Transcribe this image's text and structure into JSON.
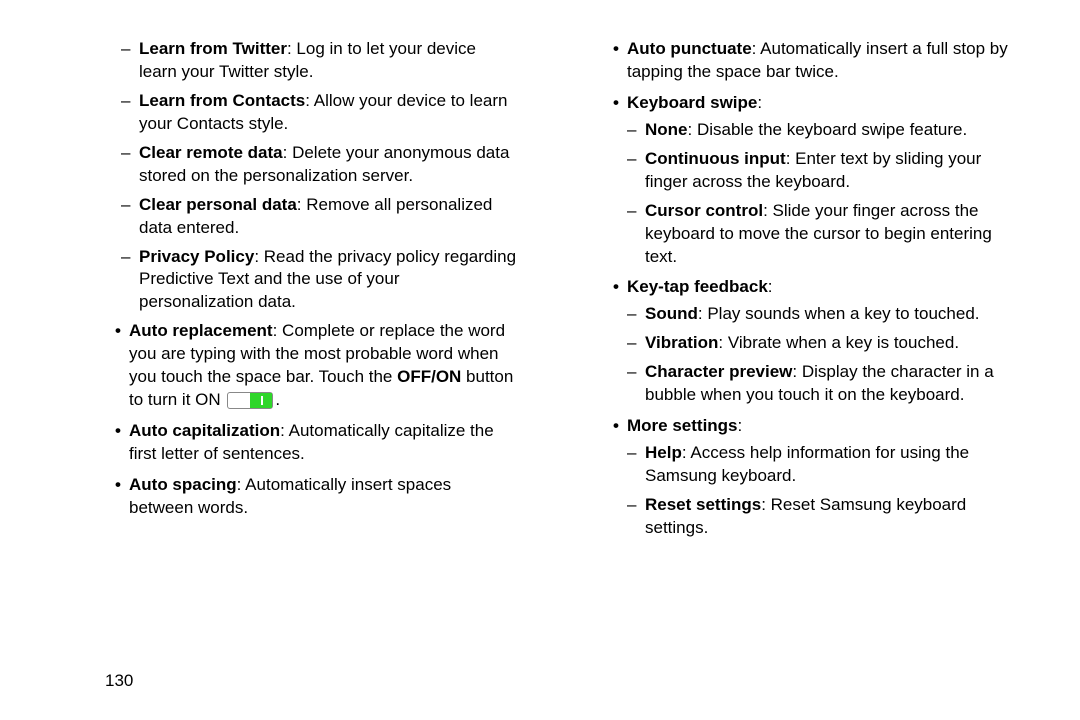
{
  "page_number": "130",
  "left": {
    "sub": [
      {
        "b": "Learn from Twitter",
        "t": ": Log in to let your device learn your Twitter style."
      },
      {
        "b": "Learn from Contacts",
        "t": ": Allow your device to learn your Contacts style."
      },
      {
        "b": "Clear remote data",
        "t": ": Delete your anonymous data stored on the personalization server."
      },
      {
        "b": "Clear personal data",
        "t": ": Remove all personalized data entered."
      },
      {
        "b": "Privacy Policy",
        "t": ": Read the privacy policy regarding Predictive Text and the use of your personalization data."
      }
    ],
    "bul": [
      {
        "b": "Auto replacement",
        "t1": ": Complete or replace the word you are typing with the most probable word when you touch the space bar. Touch the ",
        "mid_b": "OFF/ON",
        "t2": " button to turn it ON ",
        "toggle": true,
        "t3": "."
      },
      {
        "b": "Auto capitalization",
        "t": ": Automatically capitalize the first letter of sentences."
      },
      {
        "b": "Auto spacing",
        "t": ": Automatically insert spaces between words."
      }
    ]
  },
  "right": {
    "bul": [
      {
        "b": "Auto punctuate",
        "t": ": Automatically insert a full stop by tapping the space bar twice."
      },
      {
        "b": "Keyboard swipe",
        "t": ":",
        "sub": [
          {
            "b": "None",
            "t": ": Disable the keyboard swipe feature."
          },
          {
            "b": "Continuous input",
            "t": ": Enter text by sliding your finger across the keyboard."
          },
          {
            "b": "Cursor control",
            "t": ": Slide your finger across the keyboard to move the cursor to begin entering text."
          }
        ]
      },
      {
        "b": "Key-tap feedback",
        "t": ":",
        "sub": [
          {
            "b": "Sound",
            "t": ": Play sounds when a key to touched."
          },
          {
            "b": "Vibration",
            "t": ": Vibrate when a key is touched."
          },
          {
            "b": "Character preview",
            "t": ": Display the character in a bubble when you touch it on the keyboard."
          }
        ]
      },
      {
        "b": "More settings",
        "t": ":",
        "sub": [
          {
            "b": "Help",
            "t": ": Access help information for using the Samsung keyboard."
          },
          {
            "b": "Reset settings",
            "t": ": Reset Samsung keyboard settings."
          }
        ]
      }
    ]
  }
}
